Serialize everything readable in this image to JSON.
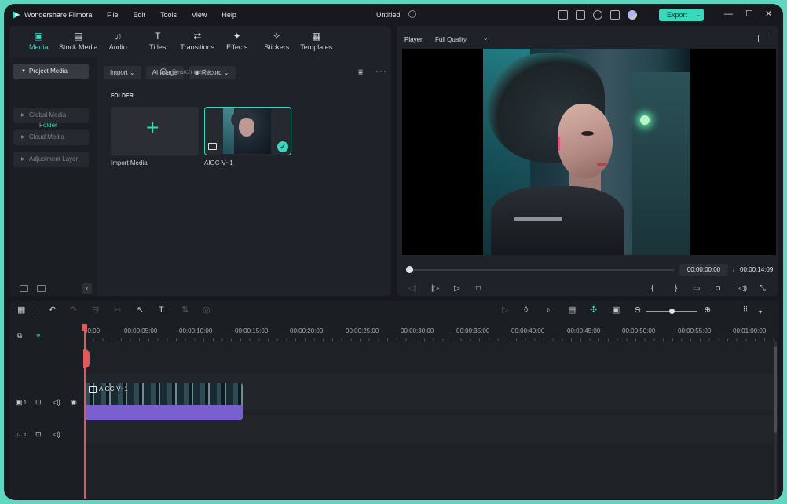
{
  "app": {
    "name": "Wondershare Filmora",
    "doc_title": "Untitled",
    "menu": [
      "File",
      "Edit",
      "Tools",
      "View",
      "Help"
    ],
    "export_label": "Export",
    "brand_color": "#39d9bd"
  },
  "media_tabs": [
    {
      "label": "Media",
      "icon": "media-icon",
      "glyph": "▣"
    },
    {
      "label": "Stock Media",
      "icon": "stock-media-icon",
      "glyph": "▤"
    },
    {
      "label": "Audio",
      "icon": "audio-icon",
      "glyph": "♫"
    },
    {
      "label": "Titles",
      "icon": "titles-icon",
      "glyph": "T"
    },
    {
      "label": "Transitions",
      "icon": "transitions-icon",
      "glyph": "⇄"
    },
    {
      "label": "Effects",
      "icon": "effects-icon",
      "glyph": "✦"
    },
    {
      "label": "Stickers",
      "icon": "stickers-icon",
      "glyph": "✧"
    },
    {
      "label": "Templates",
      "icon": "templates-icon",
      "glyph": "▦"
    }
  ],
  "sidebar": {
    "project_media": "Project Media",
    "folder": "Folder",
    "items": [
      "Global Media",
      "Cloud Media",
      "Adjustment Layer"
    ]
  },
  "media_toolbar": {
    "import": "Import",
    "ai_image": "AI Image",
    "record": "Record",
    "search_placeholder": "Search media"
  },
  "library": {
    "section": "FOLDER",
    "import_tile_label": "Import Media",
    "clip_name": "AIGC-V~1"
  },
  "player": {
    "label": "Player",
    "quality": "Full Quality",
    "current_time": "00:00:00:00",
    "separator": "/",
    "total_time": "00:00:14:09"
  },
  "timeline": {
    "ruler": [
      "00:00",
      "00:00:05:00",
      "00:00:10:00",
      "00:00:15:00",
      "00:00:20:00",
      "00:00:25:00",
      "00:00:30:00",
      "00:00:35:00",
      "00:00:40:00",
      "00:00:45:00",
      "00:00:50:00",
      "00:00:55:00",
      "00:01:00:00"
    ],
    "clip_label": "AIGC-V~1",
    "video_track_num": "1",
    "audio_track_num": "1"
  }
}
